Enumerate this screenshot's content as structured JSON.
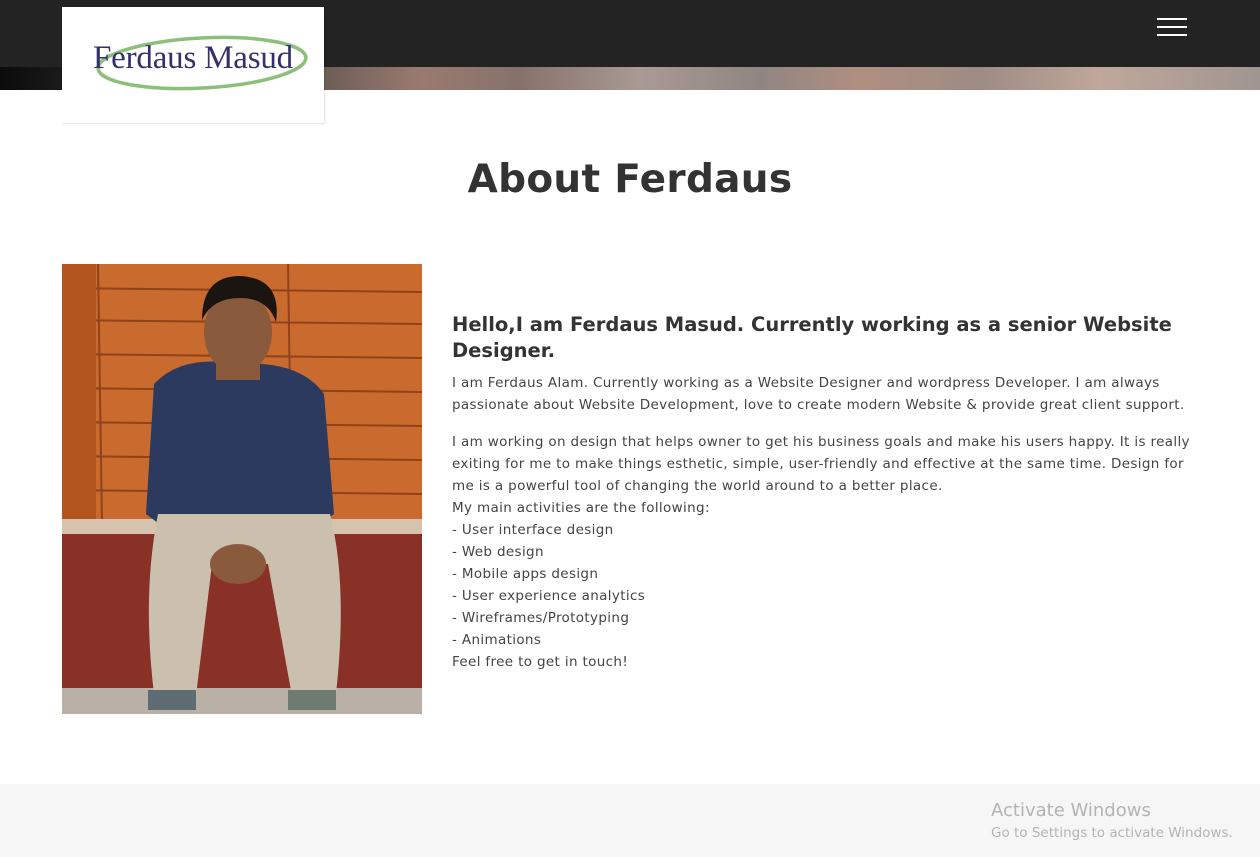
{
  "header": {
    "logo_text": "Ferdaus Masud",
    "menu_icon": "hamburger-menu-icon"
  },
  "about": {
    "title": "About Ferdaus",
    "headline": "Hello,I am Ferdaus Masud. Currently working as a senior Website Designer.",
    "intro": "I am Ferdaus Alam. Currently working as a Website Designer and wordpress Developer. I am always passionate about Website Development, love to create modern Website & provide great client support.",
    "description": "I am working on design that helps owner to get his business goals and make his users happy. It is really exiting for me to make things esthetic, simple, user-friendly and effective at the same time. Design for me is a powerful tool of changing the world around to a better place.",
    "activities_intro": "My main activities are the following:",
    "activities": [
      "- User interface design",
      "- Web design",
      "- Mobile apps design",
      "- User experience analytics",
      "- Wireframes/Prototyping",
      "- Animations"
    ],
    "closing": "Feel free to get in touch!"
  },
  "watermark": {
    "title": "Activate Windows",
    "subtitle": "Go to Settings to activate Windows."
  },
  "colors": {
    "topbar": "#232323",
    "title": "#333333",
    "text": "#444444",
    "logo_text": "#33306a",
    "logo_swoosh": "#8cc07a",
    "footer": "#f6f6f6"
  }
}
